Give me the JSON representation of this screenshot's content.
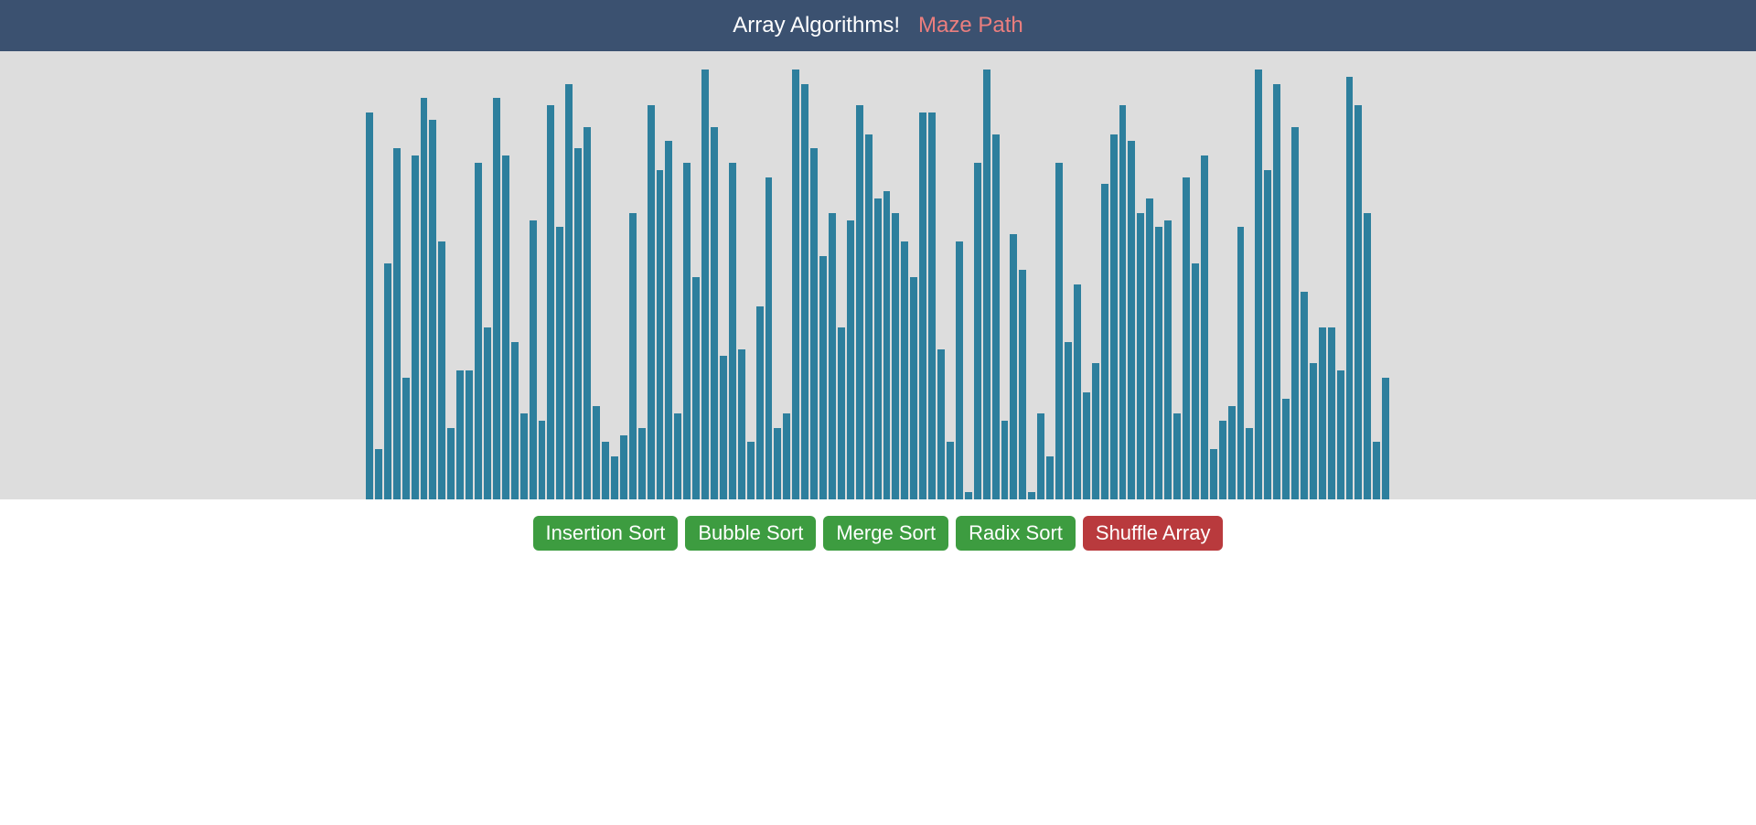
{
  "header": {
    "title_active": "Array Algorithms!",
    "title_inactive": "Maze Path"
  },
  "controls": {
    "insertion_sort": "Insertion Sort",
    "bubble_sort": "Bubble Sort",
    "merge_sort": "Merge Sort",
    "radix_sort": "Radix Sort",
    "shuffle_array": "Shuffle Array"
  },
  "chart_data": {
    "type": "bar",
    "title": "",
    "xlabel": "",
    "ylabel": "",
    "ylim": [
      0,
      300
    ],
    "categories": [],
    "values": [
      270,
      35,
      165,
      245,
      85,
      240,
      280,
      265,
      180,
      50,
      90,
      90,
      235,
      120,
      280,
      240,
      110,
      60,
      195,
      55,
      275,
      190,
      290,
      245,
      260,
      65,
      40,
      30,
      45,
      200,
      50,
      275,
      230,
      250,
      60,
      235,
      155,
      300,
      260,
      100,
      235,
      105,
      40,
      135,
      225,
      50,
      60,
      300,
      290,
      245,
      170,
      200,
      120,
      195,
      275,
      255,
      210,
      215,
      200,
      180,
      155,
      270,
      270,
      105,
      40,
      180,
      5,
      235,
      300,
      255,
      55,
      185,
      160,
      5,
      60,
      30,
      235,
      110,
      150,
      75,
      95,
      220,
      255,
      275,
      250,
      200,
      210,
      190,
      195,
      60,
      225,
      165,
      240,
      35,
      55,
      65,
      190,
      50,
      300,
      230,
      290,
      70,
      260,
      145,
      95,
      120,
      120,
      90,
      295,
      275,
      200,
      40,
      85
    ]
  },
  "colors": {
    "header_bg": "#3b5170",
    "header_active": "#ffffff",
    "header_inactive": "#eb7e7e",
    "chart_bg": "#dddddd",
    "bar_color": "#2d7f9d",
    "btn_green": "#3d9c40",
    "btn_red": "#b93a3d"
  }
}
